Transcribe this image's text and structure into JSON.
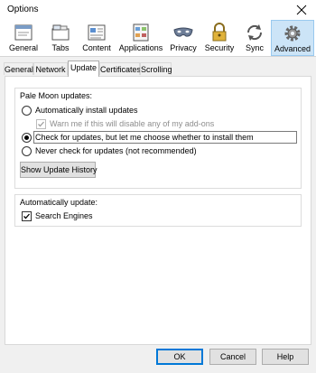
{
  "window": {
    "title": "Options"
  },
  "toolbar": {
    "items": [
      {
        "label": "General",
        "icon": "general-window-icon",
        "selected": false
      },
      {
        "label": "Tabs",
        "icon": "tabs-icon",
        "selected": false
      },
      {
        "label": "Content",
        "icon": "content-icon",
        "selected": false
      },
      {
        "label": "Applications",
        "icon": "applications-icon",
        "selected": false
      },
      {
        "label": "Privacy",
        "icon": "privacy-mask-icon",
        "selected": false
      },
      {
        "label": "Security",
        "icon": "padlock-icon",
        "selected": false
      },
      {
        "label": "Sync",
        "icon": "sync-icon",
        "selected": false
      },
      {
        "label": "Advanced",
        "icon": "gear-icon",
        "selected": true
      }
    ]
  },
  "tabs": [
    {
      "label": "General",
      "selected": false
    },
    {
      "label": "Network",
      "selected": false
    },
    {
      "label": "Update",
      "selected": true
    },
    {
      "label": "Certificates",
      "selected": false
    },
    {
      "label": "Scrolling",
      "selected": false
    }
  ],
  "updates": {
    "group_label": "Pale Moon updates:",
    "auto_install": "Automatically install updates",
    "warn_addons": "Warn me if this will disable any of my add-ons",
    "check_choose": "Check for updates, but let me choose whether to install them",
    "never_check": "Never check for updates (not recommended)",
    "selected_option": "check_choose",
    "history_button": "Show Update History"
  },
  "auto_update": {
    "group_label": "Automatically update:",
    "search_engines": "Search Engines",
    "search_engines_checked": true
  },
  "footer": {
    "ok": "OK",
    "cancel": "Cancel",
    "help": "Help"
  }
}
